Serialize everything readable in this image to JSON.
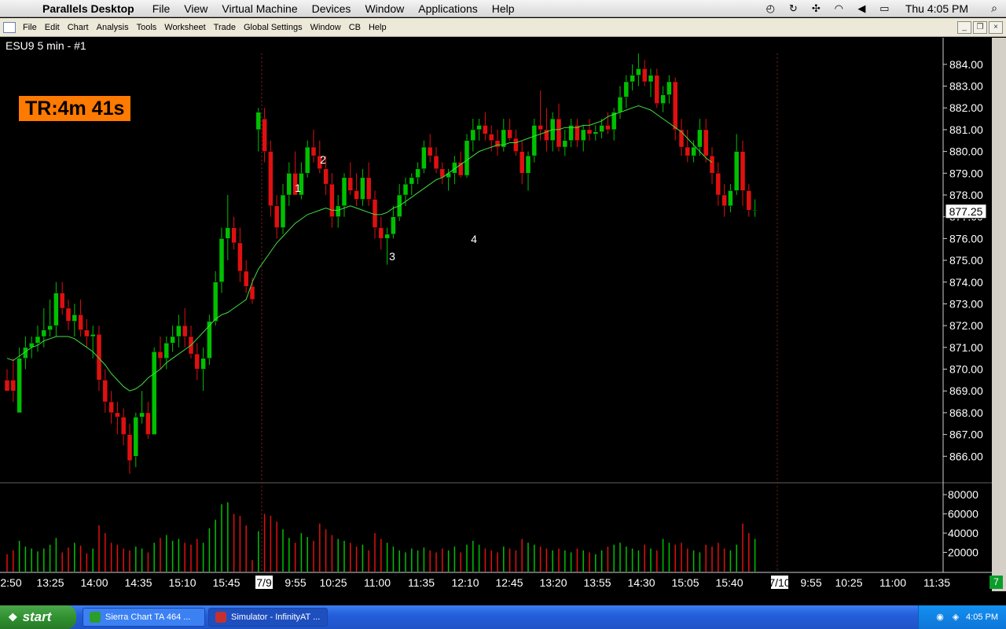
{
  "mac_menu": {
    "apple": "",
    "app_name": "Parallels Desktop",
    "items": [
      "File",
      "View",
      "Virtual Machine",
      "Devices",
      "Window",
      "Applications",
      "Help"
    ],
    "clock": "Thu 4:05 PM"
  },
  "app_menu": {
    "items": [
      "File",
      "Edit",
      "Chart",
      "Analysis",
      "Tools",
      "Worksheet",
      "Trade",
      "Global Settings",
      "Window",
      "CB",
      "Help"
    ]
  },
  "chart": {
    "title": "ESU9  5 min  - #1",
    "timer": "TR:4m 41s",
    "last_price": "877.25",
    "corner_badge": "7",
    "up_color": "#00c000",
    "down_color": "#e01010",
    "ma_color": "#40e040"
  },
  "chart_data": {
    "type": "candlestick",
    "price_ticks": [
      "884.00",
      "883.00",
      "882.00",
      "881.00",
      "880.00",
      "879.00",
      "878.00",
      "877.00",
      "876.00",
      "875.00",
      "874.00",
      "873.00",
      "872.00",
      "871.00",
      "870.00",
      "869.00",
      "868.00",
      "867.00",
      "866.00"
    ],
    "price_range": [
      865.0,
      884.5
    ],
    "volume_ticks": [
      "80000",
      "60000",
      "40000",
      "20000"
    ],
    "volume_range": [
      0,
      85000
    ],
    "time_labels": [
      "2:50",
      "13:25",
      "14:00",
      "14:35",
      "15:10",
      "15:45",
      "7/9",
      "9:55",
      "10:25",
      "11:00",
      "11:35",
      "12:10",
      "12:45",
      "13:20",
      "13:55",
      "14:30",
      "15:05",
      "15:40",
      "7/10",
      "9:55",
      "10:25",
      "11:00",
      "11:35"
    ],
    "annotations": [
      "1",
      "2",
      "3",
      "4"
    ],
    "candles": [
      {
        "o": 869.5,
        "h": 870.0,
        "l": 869.0,
        "c": 869.0
      },
      {
        "o": 869.5,
        "h": 870.5,
        "l": 868.5,
        "c": 869.0
      },
      {
        "o": 868.0,
        "h": 871.0,
        "l": 868.0,
        "c": 870.5
      },
      {
        "o": 870.5,
        "h": 871.5,
        "l": 870.0,
        "c": 871.0
      },
      {
        "o": 871.0,
        "h": 871.5,
        "l": 870.5,
        "c": 871.2
      },
      {
        "o": 871.2,
        "h": 872.0,
        "l": 870.8,
        "c": 871.5
      },
      {
        "o": 871.5,
        "h": 872.8,
        "l": 871.0,
        "c": 871.8
      },
      {
        "o": 871.8,
        "h": 873.2,
        "l": 871.5,
        "c": 872.0
      },
      {
        "o": 872.0,
        "h": 874.0,
        "l": 871.5,
        "c": 873.5
      },
      {
        "o": 873.5,
        "h": 874.0,
        "l": 872.5,
        "c": 872.8
      },
      {
        "o": 872.8,
        "h": 873.2,
        "l": 871.8,
        "c": 872.2
      },
      {
        "o": 872.2,
        "h": 873.0,
        "l": 871.5,
        "c": 872.5
      },
      {
        "o": 872.5,
        "h": 873.2,
        "l": 871.5,
        "c": 871.8
      },
      {
        "o": 871.8,
        "h": 872.3,
        "l": 871.0,
        "c": 871.5
      },
      {
        "o": 871.5,
        "h": 872.0,
        "l": 870.5,
        "c": 871.6
      },
      {
        "o": 871.6,
        "h": 872.0,
        "l": 869.0,
        "c": 869.5
      },
      {
        "o": 869.5,
        "h": 870.0,
        "l": 868.0,
        "c": 868.5
      },
      {
        "o": 868.5,
        "h": 869.0,
        "l": 867.5,
        "c": 868.0
      },
      {
        "o": 868.0,
        "h": 868.5,
        "l": 867.0,
        "c": 867.8
      },
      {
        "o": 867.8,
        "h": 868.2,
        "l": 866.5,
        "c": 867.0
      },
      {
        "o": 867.0,
        "h": 867.5,
        "l": 865.2,
        "c": 865.8
      },
      {
        "o": 866.0,
        "h": 868.0,
        "l": 865.5,
        "c": 867.8
      },
      {
        "o": 867.8,
        "h": 869.0,
        "l": 867.5,
        "c": 868.0
      },
      {
        "o": 868.0,
        "h": 868.5,
        "l": 866.8,
        "c": 867.0
      },
      {
        "o": 867.0,
        "h": 871.0,
        "l": 867.0,
        "c": 870.8
      },
      {
        "o": 870.8,
        "h": 871.5,
        "l": 870.0,
        "c": 870.5
      },
      {
        "o": 870.5,
        "h": 871.5,
        "l": 870.0,
        "c": 871.2
      },
      {
        "o": 871.2,
        "h": 872.0,
        "l": 870.8,
        "c": 871.5
      },
      {
        "o": 871.5,
        "h": 872.5,
        "l": 871.0,
        "c": 872.0
      },
      {
        "o": 872.0,
        "h": 872.8,
        "l": 871.0,
        "c": 871.5
      },
      {
        "o": 871.5,
        "h": 872.0,
        "l": 870.5,
        "c": 870.7
      },
      {
        "o": 870.7,
        "h": 871.2,
        "l": 869.5,
        "c": 870.0
      },
      {
        "o": 870.0,
        "h": 871.0,
        "l": 869.0,
        "c": 870.5
      },
      {
        "o": 870.5,
        "h": 872.5,
        "l": 870.2,
        "c": 872.2
      },
      {
        "o": 872.2,
        "h": 874.5,
        "l": 872.0,
        "c": 874.0
      },
      {
        "o": 874.0,
        "h": 876.5,
        "l": 873.5,
        "c": 876.0
      },
      {
        "o": 876.0,
        "h": 878.0,
        "l": 875.0,
        "c": 876.5
      },
      {
        "o": 876.5,
        "h": 877.0,
        "l": 875.5,
        "c": 875.8
      },
      {
        "o": 875.8,
        "h": 876.5,
        "l": 874.0,
        "c": 874.5
      },
      {
        "o": 874.5,
        "h": 875.0,
        "l": 873.5,
        "c": 873.8
      },
      {
        "o": 873.8,
        "h": 874.2,
        "l": 873.0,
        "c": 873.2
      },
      {
        "o": 881.0,
        "h": 882.0,
        "l": 880.0,
        "c": 881.8
      },
      {
        "o": 881.5,
        "h": 882.0,
        "l": 879.5,
        "c": 880.0
      },
      {
        "o": 880.0,
        "h": 880.5,
        "l": 877.0,
        "c": 877.5
      },
      {
        "o": 877.5,
        "h": 878.0,
        "l": 876.0,
        "c": 876.5
      },
      {
        "o": 876.5,
        "h": 878.5,
        "l": 876.2,
        "c": 878.0
      },
      {
        "o": 878.0,
        "h": 879.5,
        "l": 877.5,
        "c": 879.0
      },
      {
        "o": 879.0,
        "h": 880.0,
        "l": 878.5,
        "c": 878.0
      },
      {
        "o": 878.0,
        "h": 879.5,
        "l": 877.8,
        "c": 879.0
      },
      {
        "o": 879.0,
        "h": 880.5,
        "l": 878.8,
        "c": 880.2
      },
      {
        "o": 880.2,
        "h": 881.0,
        "l": 879.5,
        "c": 879.8
      },
      {
        "o": 879.8,
        "h": 880.5,
        "l": 879.0,
        "c": 879.2
      },
      {
        "o": 879.2,
        "h": 879.8,
        "l": 878.0,
        "c": 878.5
      },
      {
        "o": 878.5,
        "h": 879.0,
        "l": 876.5,
        "c": 877.0
      },
      {
        "o": 877.0,
        "h": 878.0,
        "l": 876.5,
        "c": 877.5
      },
      {
        "o": 877.5,
        "h": 879.0,
        "l": 877.0,
        "c": 878.8
      },
      {
        "o": 878.8,
        "h": 879.5,
        "l": 878.0,
        "c": 878.2
      },
      {
        "o": 878.2,
        "h": 879.0,
        "l": 877.5,
        "c": 877.8
      },
      {
        "o": 877.8,
        "h": 879.2,
        "l": 877.5,
        "c": 878.8
      },
      {
        "o": 878.8,
        "h": 879.5,
        "l": 877.5,
        "c": 877.8
      },
      {
        "o": 877.8,
        "h": 878.2,
        "l": 876.0,
        "c": 876.5
      },
      {
        "o": 876.5,
        "h": 877.0,
        "l": 875.5,
        "c": 876.0
      },
      {
        "o": 876.0,
        "h": 876.5,
        "l": 874.8,
        "c": 876.2
      },
      {
        "o": 876.2,
        "h": 877.5,
        "l": 876.0,
        "c": 877.0
      },
      {
        "o": 877.0,
        "h": 878.5,
        "l": 876.8,
        "c": 878.0
      },
      {
        "o": 878.0,
        "h": 878.8,
        "l": 877.5,
        "c": 878.5
      },
      {
        "o": 878.5,
        "h": 879.0,
        "l": 878.0,
        "c": 878.8
      },
      {
        "o": 878.8,
        "h": 879.5,
        "l": 878.5,
        "c": 879.2
      },
      {
        "o": 879.2,
        "h": 880.5,
        "l": 879.0,
        "c": 880.2
      },
      {
        "o": 880.2,
        "h": 880.8,
        "l": 879.5,
        "c": 879.8
      },
      {
        "o": 879.8,
        "h": 880.2,
        "l": 879.0,
        "c": 879.2
      },
      {
        "o": 879.2,
        "h": 879.5,
        "l": 878.5,
        "c": 878.8
      },
      {
        "o": 878.8,
        "h": 879.2,
        "l": 878.2,
        "c": 879.0
      },
      {
        "o": 879.0,
        "h": 879.8,
        "l": 878.5,
        "c": 879.5
      },
      {
        "o": 879.5,
        "h": 880.0,
        "l": 878.8,
        "c": 878.9
      },
      {
        "o": 878.9,
        "h": 880.8,
        "l": 878.8,
        "c": 880.5
      },
      {
        "o": 880.5,
        "h": 881.5,
        "l": 880.0,
        "c": 881.0
      },
      {
        "o": 881.0,
        "h": 881.5,
        "l": 880.5,
        "c": 881.2
      },
      {
        "o": 881.2,
        "h": 881.8,
        "l": 880.5,
        "c": 880.8
      },
      {
        "o": 880.8,
        "h": 881.2,
        "l": 880.0,
        "c": 880.5
      },
      {
        "o": 880.5,
        "h": 881.0,
        "l": 879.8,
        "c": 880.2
      },
      {
        "o": 880.2,
        "h": 881.5,
        "l": 880.0,
        "c": 881.0
      },
      {
        "o": 881.0,
        "h": 881.5,
        "l": 880.5,
        "c": 880.6
      },
      {
        "o": 880.6,
        "h": 881.0,
        "l": 879.8,
        "c": 880.0
      },
      {
        "o": 880.0,
        "h": 880.5,
        "l": 878.5,
        "c": 879.0
      },
      {
        "o": 879.0,
        "h": 880.0,
        "l": 878.2,
        "c": 879.8
      },
      {
        "o": 879.8,
        "h": 881.5,
        "l": 879.5,
        "c": 881.2
      },
      {
        "o": 881.2,
        "h": 882.8,
        "l": 880.5,
        "c": 881.0
      },
      {
        "o": 881.0,
        "h": 882.0,
        "l": 880.0,
        "c": 880.5
      },
      {
        "o": 880.5,
        "h": 881.8,
        "l": 880.0,
        "c": 881.5
      },
      {
        "o": 881.5,
        "h": 882.2,
        "l": 880.0,
        "c": 880.2
      },
      {
        "o": 880.2,
        "h": 881.0,
        "l": 879.8,
        "c": 880.5
      },
      {
        "o": 880.5,
        "h": 881.5,
        "l": 880.2,
        "c": 881.2
      },
      {
        "o": 881.2,
        "h": 881.5,
        "l": 880.2,
        "c": 880.5
      },
      {
        "o": 880.5,
        "h": 881.2,
        "l": 880.0,
        "c": 881.0
      },
      {
        "o": 881.0,
        "h": 881.5,
        "l": 880.5,
        "c": 880.8
      },
      {
        "o": 880.8,
        "h": 881.2,
        "l": 880.5,
        "c": 880.9
      },
      {
        "o": 880.9,
        "h": 881.5,
        "l": 880.6,
        "c": 881.2
      },
      {
        "o": 881.2,
        "h": 881.8,
        "l": 880.8,
        "c": 881.0
      },
      {
        "o": 881.0,
        "h": 882.0,
        "l": 880.5,
        "c": 881.8
      },
      {
        "o": 881.8,
        "h": 883.0,
        "l": 881.5,
        "c": 882.5
      },
      {
        "o": 882.5,
        "h": 883.5,
        "l": 882.0,
        "c": 883.2
      },
      {
        "o": 883.2,
        "h": 884.0,
        "l": 882.8,
        "c": 883.5
      },
      {
        "o": 883.5,
        "h": 884.5,
        "l": 883.0,
        "c": 883.8
      },
      {
        "o": 883.8,
        "h": 884.2,
        "l": 883.0,
        "c": 883.2
      },
      {
        "o": 883.2,
        "h": 883.8,
        "l": 882.5,
        "c": 883.5
      },
      {
        "o": 883.5,
        "h": 883.8,
        "l": 882.0,
        "c": 882.2
      },
      {
        "o": 882.2,
        "h": 883.0,
        "l": 881.8,
        "c": 882.6
      },
      {
        "o": 882.6,
        "h": 883.5,
        "l": 882.2,
        "c": 883.2
      },
      {
        "o": 883.2,
        "h": 883.4,
        "l": 880.5,
        "c": 881.0
      },
      {
        "o": 881.0,
        "h": 881.5,
        "l": 879.8,
        "c": 880.2
      },
      {
        "o": 880.2,
        "h": 881.0,
        "l": 879.5,
        "c": 879.8
      },
      {
        "o": 879.8,
        "h": 880.5,
        "l": 879.5,
        "c": 880.2
      },
      {
        "o": 880.2,
        "h": 881.5,
        "l": 879.8,
        "c": 881.0
      },
      {
        "o": 881.0,
        "h": 881.5,
        "l": 879.5,
        "c": 879.8
      },
      {
        "o": 879.8,
        "h": 880.2,
        "l": 878.5,
        "c": 879.0
      },
      {
        "o": 879.0,
        "h": 879.5,
        "l": 877.5,
        "c": 878.0
      },
      {
        "o": 878.0,
        "h": 878.5,
        "l": 877.0,
        "c": 877.5
      },
      {
        "o": 877.5,
        "h": 878.5,
        "l": 877.2,
        "c": 878.2
      },
      {
        "o": 878.2,
        "h": 880.8,
        "l": 878.0,
        "c": 880.0
      },
      {
        "o": 880.0,
        "h": 880.5,
        "l": 877.5,
        "c": 878.2
      },
      {
        "o": 878.2,
        "h": 878.5,
        "l": 877.0,
        "c": 877.3
      },
      {
        "o": 877.3,
        "h": 877.8,
        "l": 877.0,
        "c": 877.3
      }
    ],
    "ma": [
      870.5,
      870.4,
      870.6,
      870.8,
      871.0,
      871.1,
      871.3,
      871.4,
      871.5,
      871.5,
      871.5,
      871.4,
      871.2,
      871.0,
      870.8,
      870.5,
      870.2,
      869.8,
      869.5,
      869.2,
      869.0,
      869.1,
      869.3,
      869.6,
      869.8,
      870.0,
      870.3,
      870.5,
      870.7,
      870.9,
      871.1,
      871.4,
      871.7,
      872.0,
      872.3,
      872.5,
      872.6,
      872.8,
      873.0,
      873.2,
      874.0,
      874.6,
      875.0,
      875.4,
      875.8,
      876.1,
      876.4,
      876.7,
      876.9,
      877.1,
      877.2,
      877.3,
      877.4,
      877.3,
      877.3,
      877.4,
      877.5,
      877.4,
      877.3,
      877.2,
      877.1,
      877.1,
      877.2,
      877.4,
      877.5,
      877.7,
      877.9,
      878.1,
      878.3,
      878.5,
      878.7,
      878.8,
      879.0,
      879.2,
      879.4,
      879.6,
      879.8,
      880.0,
      880.1,
      880.2,
      880.3,
      880.3,
      880.4,
      880.4,
      880.5,
      880.6,
      880.7,
      880.8,
      880.9,
      881.0,
      881.0,
      881.1,
      881.1,
      881.1,
      881.2,
      881.2,
      881.3,
      881.4,
      881.6,
      881.7,
      881.8,
      881.9,
      882.0,
      882.1,
      882.0,
      881.9,
      881.7,
      881.5,
      881.3,
      881.1,
      880.9,
      880.6,
      880.3,
      880.0,
      879.7,
      879.5
    ],
    "volume": [
      18000,
      22000,
      32000,
      26000,
      24000,
      21000,
      24000,
      28000,
      35000,
      20000,
      25000,
      30000,
      27000,
      19000,
      24000,
      48000,
      40000,
      30000,
      28000,
      24000,
      22000,
      26000,
      24000,
      20000,
      30000,
      35000,
      38000,
      32000,
      34000,
      30000,
      28000,
      34000,
      30000,
      45000,
      54000,
      70000,
      72000,
      60000,
      58000,
      48000,
      12000,
      42000,
      60000,
      58000,
      52000,
      44000,
      35000,
      30000,
      40000,
      36000,
      32000,
      50000,
      44000,
      38000,
      34000,
      32000,
      30000,
      26000,
      28000,
      22000,
      40000,
      34000,
      30000,
      26000,
      22000,
      20000,
      24000,
      22000,
      25000,
      22000,
      20000,
      24000,
      22000,
      26000,
      20000,
      28000,
      32000,
      28000,
      24000,
      22000,
      20000,
      26000,
      24000,
      22000,
      34000,
      30000,
      28000,
      26000,
      24000,
      22000,
      24000,
      22000,
      20000,
      24000,
      22000,
      20000,
      18000,
      22000,
      26000,
      28000,
      30000,
      26000,
      24000,
      22000,
      28000,
      24000,
      22000,
      34000,
      30000,
      28000,
      30000,
      24000,
      22000,
      20000,
      28000,
      26000,
      30000,
      24000,
      22000,
      28000,
      50000,
      40000,
      34000
    ]
  }
}
